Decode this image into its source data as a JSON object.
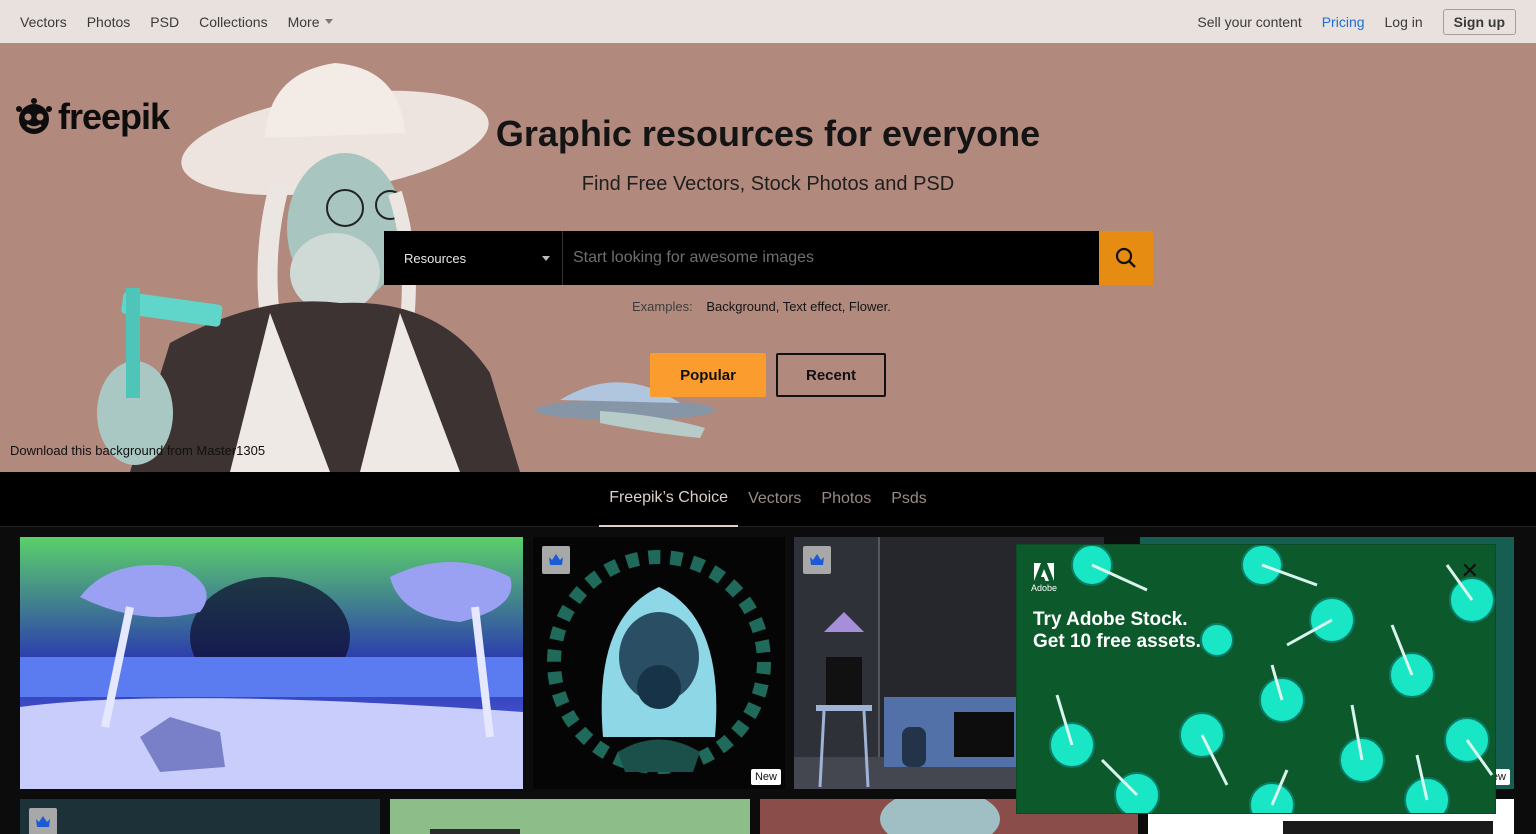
{
  "nav": {
    "left": [
      "Vectors",
      "Photos",
      "PSD",
      "Collections"
    ],
    "more": "More",
    "sell": "Sell your content",
    "pricing": "Pricing",
    "login": "Log in",
    "signup": "Sign up"
  },
  "hero": {
    "logo": "freepik",
    "title": "Graphic resources for everyone",
    "subtitle": "Find Free Vectors, Stock Photos and PSD",
    "search": {
      "category": "Resources",
      "placeholder": "Start looking for awesome images"
    },
    "examples_label": "Examples:",
    "examples": "Background, Text effect, Flower.",
    "popular": "Popular",
    "recent": "Recent",
    "credit": "Download this background from Master1305"
  },
  "tabs": [
    "Freepik’s Choice",
    "Vectors",
    "Photos",
    "Psds"
  ],
  "grid": {
    "new_label": "New"
  },
  "ad": {
    "brand": "Adobe",
    "line1": "Try Adobe Stock.",
    "line2": "Get 10 free assets."
  }
}
